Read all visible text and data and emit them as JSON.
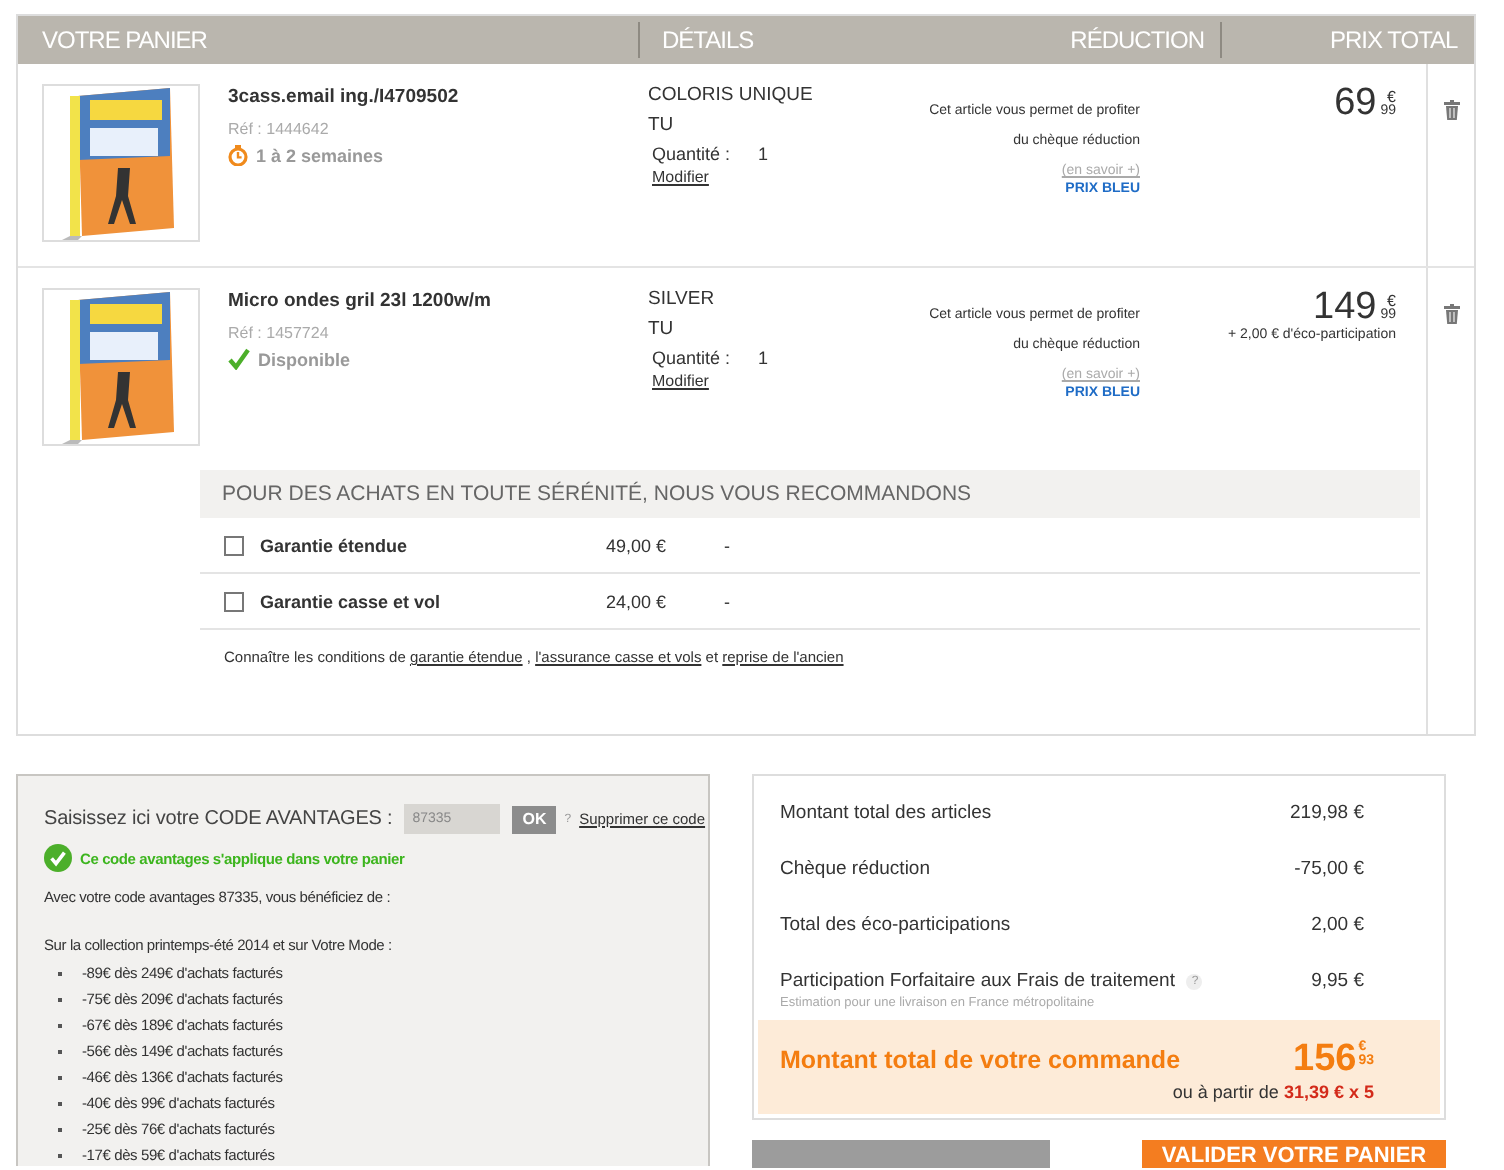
{
  "cart": {
    "columns": [
      "VOTRE PANIER",
      "DÉTAILS",
      "RÉDUCTION",
      "PRIX TOTAL"
    ],
    "items": [
      {
        "name": "3cass.email ing./I4709502",
        "ref": "Réf : 1444642",
        "availability": {
          "kind": "delay",
          "text": "1 à 2 semaines"
        },
        "details": [
          "COLORIS UNIQUE",
          "TU"
        ],
        "quantity_label": "Quantité :",
        "quantity": "1",
        "modify": "Modifier",
        "reduction": {
          "lines": [
            "Cet article vous permet de profiter",
            "du chèque réduction"
          ],
          "link": "(en savoir +)",
          "tag": "PRIX BLEU"
        },
        "price": {
          "euros": "69",
          "currency": "€",
          "cents": "99"
        }
      },
      {
        "name": "Micro ondes gril 23l 1200w/m",
        "ref": "Réf : 1457724",
        "availability": {
          "kind": "stock",
          "text": "Disponible"
        },
        "details": [
          "SILVER",
          "TU"
        ],
        "quantity_label": "Quantité :",
        "quantity": "1",
        "modify": "Modifier",
        "reduction": {
          "lines": [
            "Cet article vous permet de profiter",
            "du chèque réduction"
          ],
          "link": "(en savoir +)",
          "tag": "PRIX BLEU"
        },
        "price": {
          "euros": "149",
          "currency": "€",
          "cents": "99"
        },
        "eco": "+ 2,00 € d'éco-participation",
        "recommendations": {
          "title": "POUR DES ACHATS EN TOUTE SÉRÉNITÉ, NOUS VOUS RECOMMANDONS",
          "options": [
            {
              "label": "Garantie étendue",
              "price": "49,00 €",
              "extra": "-",
              "checked": false
            },
            {
              "label": "Garantie casse et vol",
              "price": "24,00 €",
              "extra": "-",
              "checked": false
            }
          ],
          "note": [
            {
              "kind": "text",
              "text": "Connaître les conditions de "
            },
            {
              "kind": "link",
              "text": "garantie étendue"
            },
            {
              "kind": "text",
              "text": " , "
            },
            {
              "kind": "link",
              "text": "l'assurance casse et vols"
            },
            {
              "kind": "text",
              "text": " et "
            },
            {
              "kind": "link",
              "text": "reprise de l'ancien"
            }
          ]
        }
      }
    ]
  },
  "promo": {
    "label": "Saisissez ici votre CODE AVANTAGES :",
    "code": "87335",
    "ok": "OK",
    "help": "?",
    "remove": "Supprimer ce code",
    "success": "Ce code avantages s'applique dans votre panier",
    "intro": "Avec votre code avantages 87335, vous bénéficiez de :",
    "collection": "Sur la collection printemps-été 2014 et sur Votre Mode :",
    "tiers": [
      "-89€ dès 249€ d'achats facturés",
      "-75€ dès 209€ d'achats facturés",
      "-67€ dès 189€ d'achats facturés",
      "-56€ dès 149€ d'achats facturés",
      "-46€ dès 136€ d'achats facturés",
      "-40€ dès 99€ d'achats facturés",
      "-25€ dès 76€ d'achats facturés",
      "-17€ dès 59€ d'achats facturés"
    ]
  },
  "summary": {
    "rows": [
      {
        "label": "Montant total des articles",
        "value": "219,98 €"
      },
      {
        "label": "Chèque réduction",
        "value": "-75,00 €"
      },
      {
        "label": "Total des éco-participations",
        "value": "2,00 €"
      },
      {
        "label": "Participation Forfaitaire aux Frais de traitement",
        "help": "?",
        "value": "9,95 €",
        "sub": "Estimation pour une livraison en France métropolitaine"
      }
    ],
    "total": {
      "label": "Montant total de votre commande",
      "euros": "156",
      "currency": "€",
      "cents": "93",
      "installment_prefix": "ou à partir de ",
      "installment": "31,39 € x 5"
    }
  },
  "buttons": [
    {
      "kind": "secondary"
    },
    {
      "kind": "primary",
      "label": "VALIDER VOTRE PANIER"
    }
  ]
}
